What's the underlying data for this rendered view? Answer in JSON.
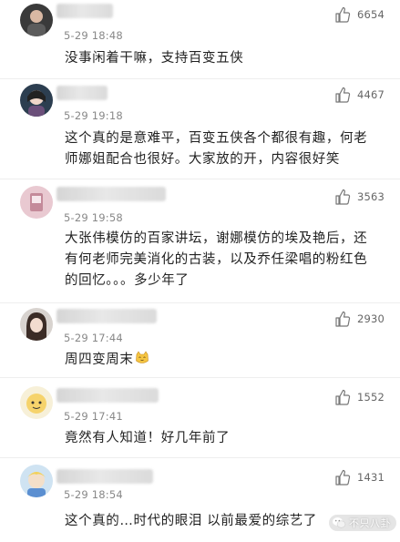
{
  "comments": [
    {
      "time": "5-29 18:48",
      "likes": "6654",
      "text": "没事闲着干嘛，支持百变五侠"
    },
    {
      "time": "5-29 19:18",
      "likes": "4467",
      "text": "这个真的是意难平，百变五侠各个都很有趣，何老师娜姐配合也很好。大家放的开，内容很好笑"
    },
    {
      "time": "5-29 19:58",
      "likes": "3563",
      "text": "大张伟模仿的百家讲坛，谢娜模仿的埃及艳后，还有何老师完美消化的古装，以及乔任梁唱的粉红色的回忆。。。多少年了"
    },
    {
      "time": "5-29 17:44",
      "likes": "2930",
      "text": "周四变周末"
    },
    {
      "time": "5-29 17:41",
      "likes": "1552",
      "text": "竟然有人知道！好几年前了"
    },
    {
      "time": "5-29 18:54",
      "likes": "1431",
      "text": "这个真的…时代的眼泪 以前最爱的综艺了"
    }
  ],
  "icons": {
    "like": "thumbs-up-icon",
    "emoji": "cat-face-icon",
    "watermark": "wechat-icon"
  },
  "watermark": {
    "text": "不只八卦"
  },
  "colors": {
    "time": "#888888",
    "count": "#666666",
    "text": "#222222"
  }
}
